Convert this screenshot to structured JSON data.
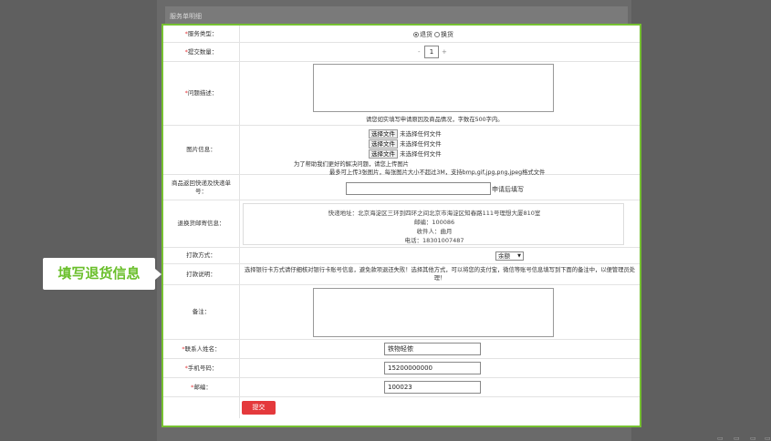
{
  "section_title": "服务单明细",
  "callout_label": "填写退货信息",
  "form": {
    "service_type": {
      "label": "服务类型：",
      "options": [
        "退货",
        "换货"
      ],
      "selected": "退货"
    },
    "quantity": {
      "label": "提交数量：",
      "minus": "-",
      "value": "1",
      "plus": "+"
    },
    "problem": {
      "label": "问题描述：",
      "hint": "请您如实填写申请原因及商品情况，字数在500字内。"
    },
    "images": {
      "label": "图片信息：",
      "button_label": "选择文件",
      "no_file": "未选择任何文件",
      "hint1": "为了帮助我们更好的解决问题，请您上传图片",
      "hint2": "最多可上传3张图片，每张图片大小不超过3M，支持bmp,gif,jpg,png,jpeg格式文件"
    },
    "tracking": {
      "label": "商品返回快递及快递单号：",
      "suffix": "申请后填写"
    },
    "address": {
      "label": "退换货邮寄信息：",
      "line1": "快递地址：北京海淀区三环到四环之间北京市海淀区知春路111号理想大厦810室",
      "line2": "邮编：100086",
      "line3": "收件人：曲月",
      "line4": "电话：18301007487"
    },
    "payment_method": {
      "label": "打款方式：",
      "selected": "余额"
    },
    "payment_note": {
      "label": "打款说明：",
      "text": "选择银行卡方式请仔细核对银行卡账号信息，避免款项退还失败！选择其他方式，可以将您的支付宝，微信等账号信息填写到下面的备注中，以便管理员处理！"
    },
    "remark": {
      "label": "备注："
    },
    "contact": {
      "label": "联系人姓名：",
      "value": "铁物轻侬"
    },
    "phone": {
      "label": "手机号码：",
      "value": "15200000000"
    },
    "postcode": {
      "label": "邮编：",
      "value": "100023"
    },
    "required_mark": "*",
    "submit_label": "提交"
  },
  "colors": {
    "accent_green": "#76c131",
    "submit_red": "#e4393c",
    "overlay": "#5f5f5f"
  }
}
